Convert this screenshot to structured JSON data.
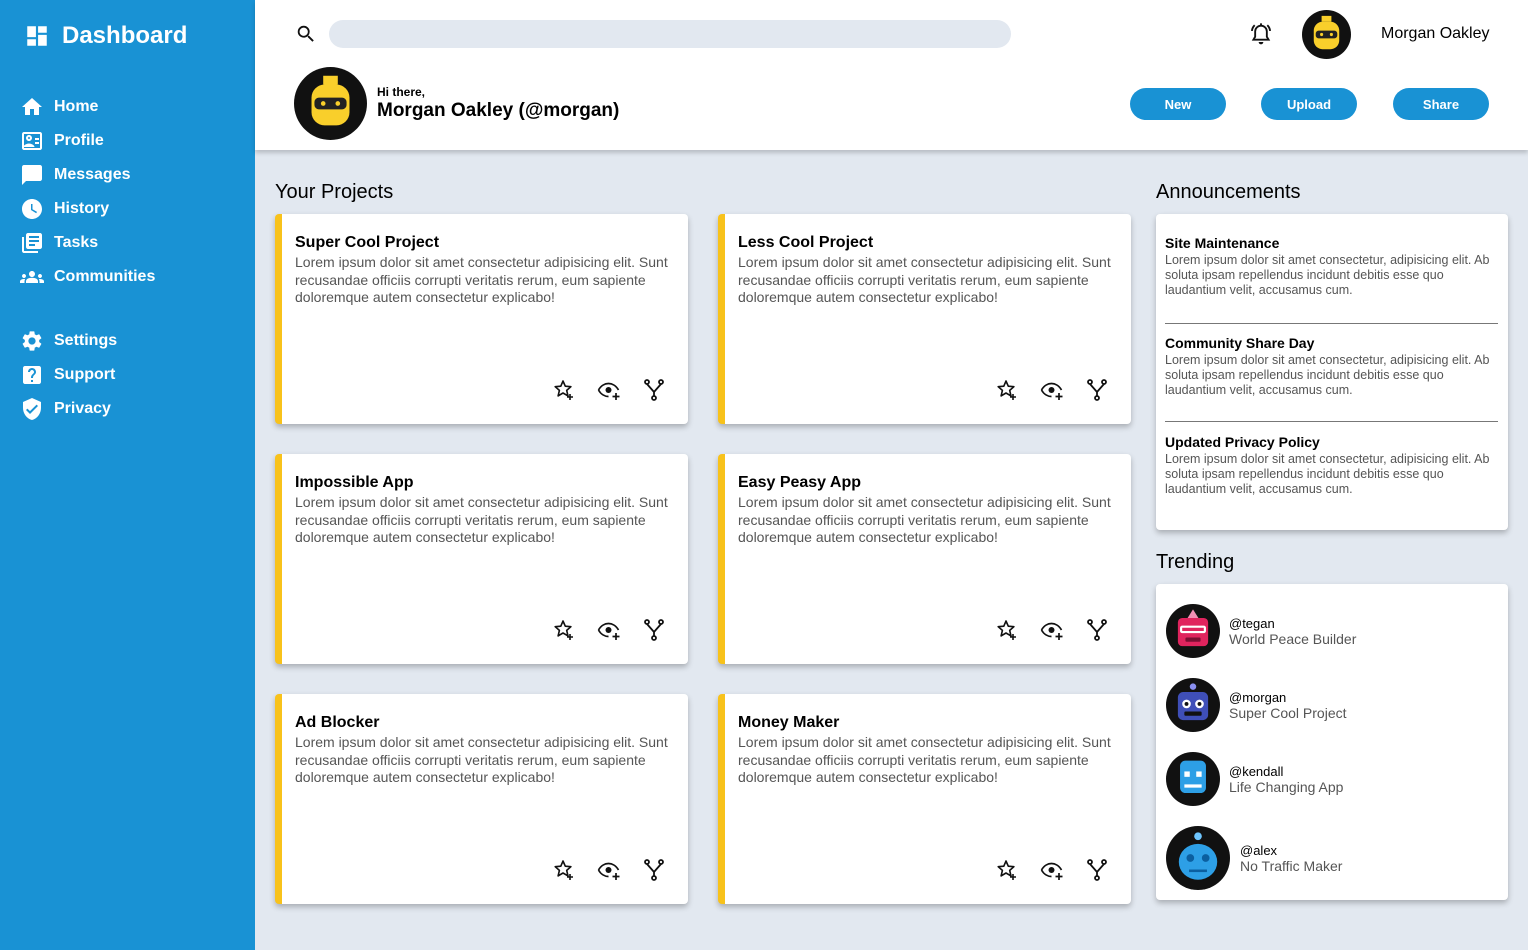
{
  "brand": {
    "title": "Dashboard"
  },
  "sidebar": {
    "items": [
      {
        "label": "Home",
        "icon": "home-icon"
      },
      {
        "label": "Profile",
        "icon": "profile-card-icon"
      },
      {
        "label": "Messages",
        "icon": "message-icon"
      },
      {
        "label": "History",
        "icon": "clock-icon"
      },
      {
        "label": "Tasks",
        "icon": "documents-icon"
      },
      {
        "label": "Communities",
        "icon": "group-icon"
      }
    ],
    "secondary": [
      {
        "label": "Settings",
        "icon": "gear-icon"
      },
      {
        "label": "Support",
        "icon": "help-icon"
      },
      {
        "label": "Privacy",
        "icon": "shield-check-icon"
      }
    ]
  },
  "header": {
    "search": {
      "value": "",
      "placeholder": ""
    },
    "user_name": "Morgan Oakley",
    "greeting": "Hi there,",
    "full_name": "Morgan Oakley (@morgan)",
    "buttons": {
      "new": "New",
      "upload": "Upload",
      "share": "Share"
    }
  },
  "projects": {
    "title": "Your Projects",
    "items": [
      {
        "title": "Super Cool Project",
        "desc": "Lorem ipsum dolor sit amet consectetur adipisicing elit. Sunt recusandae officiis corrupti veritatis rerum, eum sapiente doloremque autem consectetur explicabo!"
      },
      {
        "title": "Less Cool Project",
        "desc": "Lorem ipsum dolor sit amet consectetur adipisicing elit. Sunt recusandae officiis corrupti veritatis rerum, eum sapiente doloremque autem consectetur explicabo!"
      },
      {
        "title": "Impossible App",
        "desc": "Lorem ipsum dolor sit amet consectetur adipisicing elit. Sunt recusandae officiis corrupti veritatis rerum, eum sapiente doloremque autem consectetur explicabo!"
      },
      {
        "title": "Easy Peasy App",
        "desc": "Lorem ipsum dolor sit amet consectetur adipisicing elit. Sunt recusandae officiis corrupti veritatis rerum, eum sapiente doloremque autem consectetur explicabo!"
      },
      {
        "title": "Ad Blocker",
        "desc": "Lorem ipsum dolor sit amet consectetur adipisicing elit. Sunt recusandae officiis corrupti veritatis rerum, eum sapiente doloremque autem consectetur explicabo!"
      },
      {
        "title": "Money Maker",
        "desc": "Lorem ipsum dolor sit amet consectetur adipisicing elit. Sunt recusandae officiis corrupti veritatis rerum, eum sapiente doloremque autem consectetur explicabo!"
      }
    ]
  },
  "announcements": {
    "title": "Announcements",
    "items": [
      {
        "title": "Site Maintenance",
        "text": "Lorem ipsum dolor sit amet consectetur, adipisicing elit. Ab soluta ipsam repellendus incidunt debitis esse quo laudantium velit, accusamus cum."
      },
      {
        "title": "Community Share Day",
        "text": "Lorem ipsum dolor sit amet consectetur, adipisicing elit. Ab soluta ipsam repellendus incidunt debitis esse quo laudantium velit, accusamus cum."
      },
      {
        "title": "Updated Privacy Policy",
        "text": "Lorem ipsum dolor sit amet consectetur, adipisicing elit. Ab soluta ipsam repellendus incidunt debitis esse quo laudantium velit, accusamus cum."
      }
    ]
  },
  "trending": {
    "title": "Trending",
    "items": [
      {
        "handle": "@tegan",
        "project": "World Peace Builder"
      },
      {
        "handle": "@morgan",
        "project": "Super Cool Project"
      },
      {
        "handle": "@kendall",
        "project": "Life Changing App"
      },
      {
        "handle": "@alex",
        "project": "No Traffic Maker"
      }
    ]
  },
  "colors": {
    "accent": "#1992d4",
    "card_stripe": "#f8c21b",
    "background": "#e2e8f0"
  }
}
